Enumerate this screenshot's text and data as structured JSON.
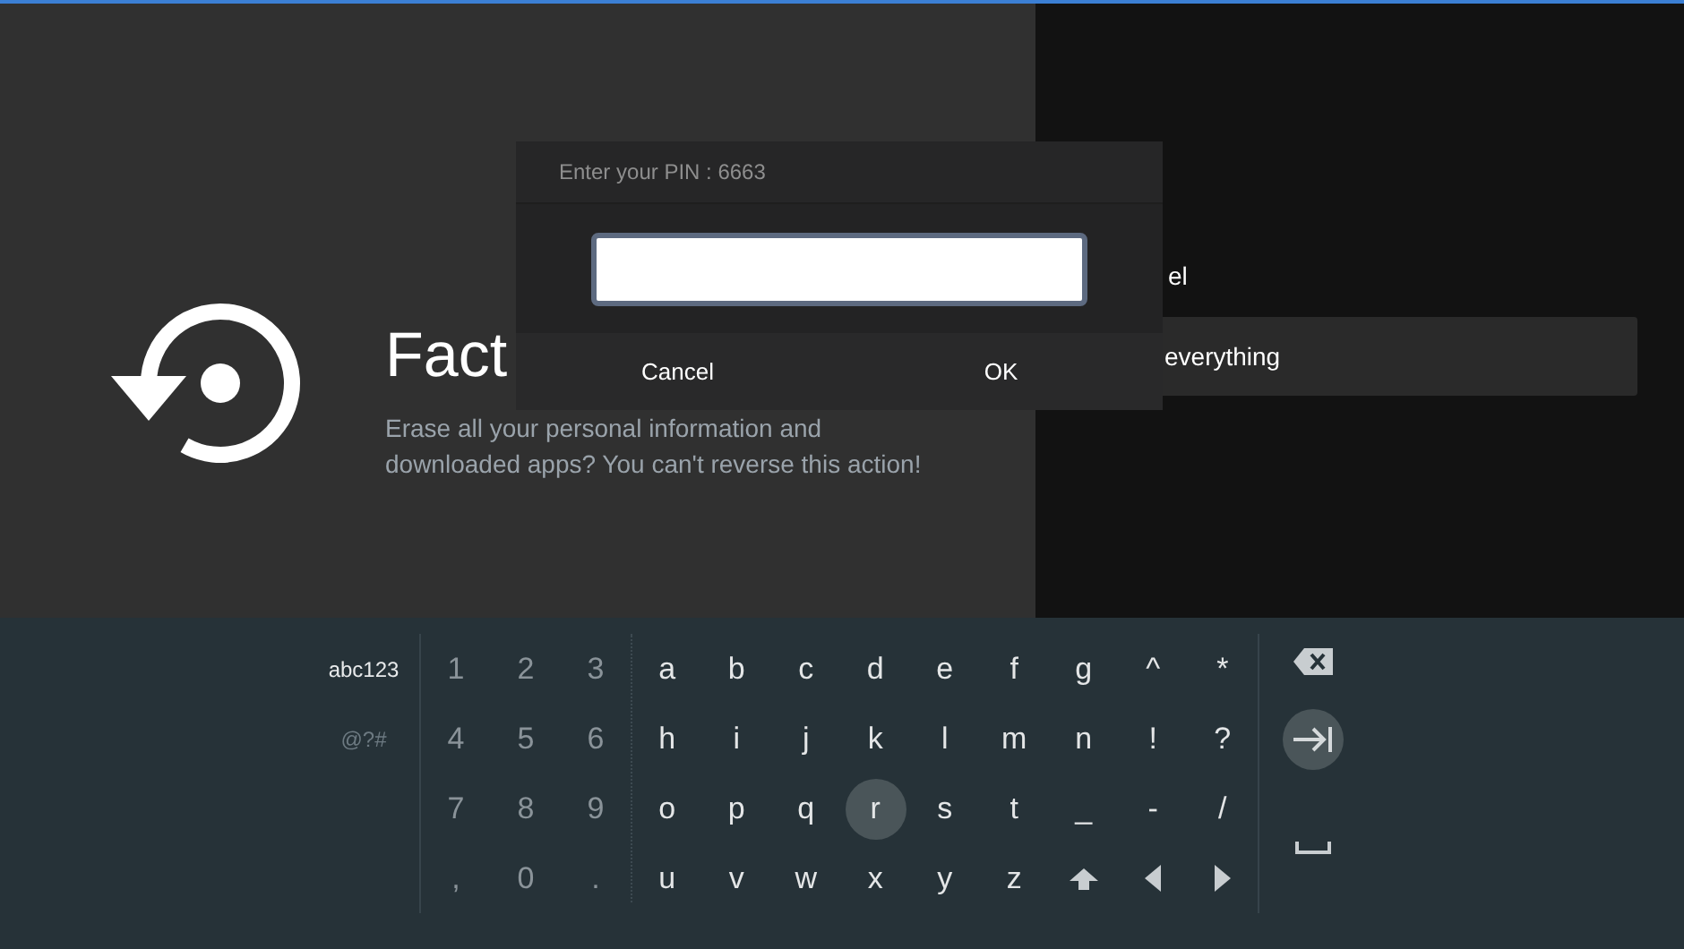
{
  "settings_page": {
    "title": "Fact",
    "description": "Erase all your personal information and downloaded apps? You can't reverse this action!"
  },
  "side_panel": {
    "label": "el",
    "option": "everything"
  },
  "pin_dialog": {
    "title": "Enter your PIN : 6663",
    "buttons": [
      "Cancel",
      "OK"
    ]
  },
  "keyboard": {
    "modes": [
      {
        "label": "abc123",
        "selected": true
      },
      {
        "label": "@?#",
        "selected": false
      }
    ],
    "digit_keys": [
      [
        {
          "label": "1"
        },
        {
          "label": "2"
        },
        {
          "label": "3"
        }
      ],
      [
        {
          "label": "4"
        },
        {
          "label": "5"
        },
        {
          "label": "6"
        }
      ],
      [
        {
          "label": "7"
        },
        {
          "label": "8"
        },
        {
          "label": "9"
        }
      ],
      [
        {
          "label": ","
        },
        {
          "label": "0"
        },
        {
          "label": "."
        }
      ]
    ],
    "letter_keys": [
      [
        {
          "kind": "char",
          "label": "a",
          "selected": false
        },
        {
          "kind": "char",
          "label": "b",
          "selected": false
        },
        {
          "kind": "char",
          "label": "c",
          "selected": false
        },
        {
          "kind": "char",
          "label": "d",
          "selected": false
        },
        {
          "kind": "char",
          "label": "e",
          "selected": false
        },
        {
          "kind": "char",
          "label": "f",
          "selected": false
        },
        {
          "kind": "char",
          "label": "g",
          "selected": false
        },
        {
          "kind": "char",
          "label": "^",
          "selected": false
        },
        {
          "kind": "char",
          "label": "*",
          "selected": false
        }
      ],
      [
        {
          "kind": "char",
          "label": "h",
          "selected": false
        },
        {
          "kind": "char",
          "label": "i",
          "selected": false
        },
        {
          "kind": "char",
          "label": "j",
          "selected": false
        },
        {
          "kind": "char",
          "label": "k",
          "selected": false
        },
        {
          "kind": "char",
          "label": "l",
          "selected": false
        },
        {
          "kind": "char",
          "label": "m",
          "selected": false
        },
        {
          "kind": "char",
          "label": "n",
          "selected": false
        },
        {
          "kind": "char",
          "label": "!",
          "selected": false
        },
        {
          "kind": "char",
          "label": "?",
          "selected": false
        }
      ],
      [
        {
          "kind": "char",
          "label": "o",
          "selected": false
        },
        {
          "kind": "char",
          "label": "p",
          "selected": false
        },
        {
          "kind": "char",
          "label": "q",
          "selected": false
        },
        {
          "kind": "char",
          "label": "r",
          "selected": true
        },
        {
          "kind": "char",
          "label": "s",
          "selected": false
        },
        {
          "kind": "char",
          "label": "t",
          "selected": false
        },
        {
          "kind": "char",
          "label": "_",
          "selected": false
        },
        {
          "kind": "char",
          "label": "-",
          "selected": false
        },
        {
          "kind": "char",
          "label": "/",
          "selected": false
        }
      ],
      [
        {
          "kind": "char",
          "label": "u",
          "selected": false
        },
        {
          "kind": "char",
          "label": "v",
          "selected": false
        },
        {
          "kind": "char",
          "label": "w",
          "selected": false
        },
        {
          "kind": "char",
          "label": "x",
          "selected": false
        },
        {
          "kind": "char",
          "label": "y",
          "selected": false
        },
        {
          "kind": "char",
          "label": "z",
          "selected": false
        },
        {
          "kind": "shift",
          "selected": false
        },
        {
          "kind": "left",
          "selected": false
        },
        {
          "kind": "right",
          "selected": false
        }
      ]
    ],
    "action_keys": [
      {
        "kind": "backspace",
        "selected": false
      },
      {
        "kind": "enter",
        "selected": true
      },
      {
        "kind": "space",
        "selected": false
      }
    ]
  }
}
